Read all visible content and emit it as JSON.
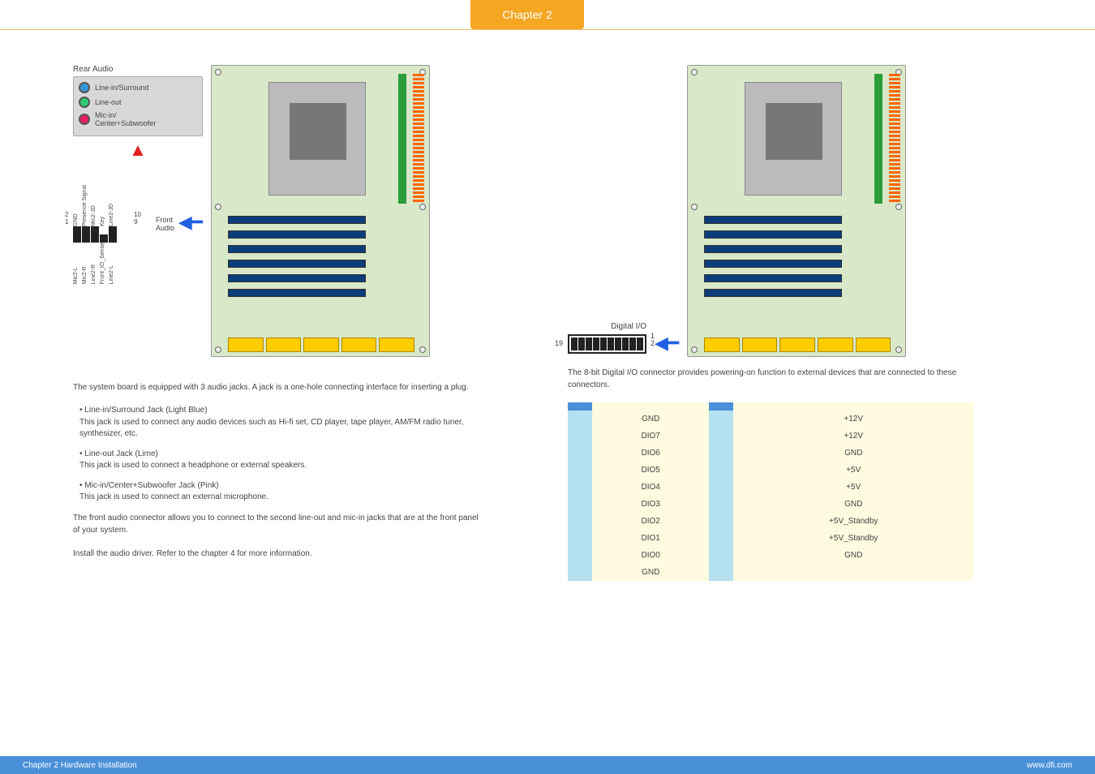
{
  "chapter_tab": "Chapter 2",
  "left": {
    "rear_audio_title": "Rear Audio",
    "jacks": {
      "linein": "Line-in/Surround",
      "lineout": "Line-out",
      "micin": "Mic-in/\nCenter+Subwoofer"
    },
    "front_audio_label": "Front\nAudio",
    "fa_top": [
      "GND",
      "Presence Signal",
      "Mic2-JD",
      "Key",
      "Line2-JD"
    ],
    "fa_bot": [
      "Mic2-L",
      "Mic2-R",
      "Line2-R",
      "Front_IO_Sense",
      "Line2-L"
    ],
    "fa_num": {
      "tl": "2",
      "bl": "1",
      "tr": "10",
      "br": "9"
    },
    "intro": "The system board is equipped with 3 audio jacks. A jack is a one-hole connecting interface for inserting a plug.",
    "bullets": [
      {
        "title": "Line-in/Surround Jack (Light Blue)",
        "body": "This jack is used to connect any audio devices such as Hi-fi set, CD player, tape player, AM/FM radio tuner, synthesizer, etc."
      },
      {
        "title": "Line-out Jack (Lime)",
        "body": "This jack is used to connect a headphone or external speakers."
      },
      {
        "title": "Mic-in/Center+Subwoofer Jack (Pink)",
        "body": "This jack is used to connect an external microphone."
      }
    ],
    "front_audio_desc": "The front audio connector allows you to connect to the second line-out and mic-in jacks that are at the front panel of your system.",
    "driver_note": "Install the audio driver. Refer to the chapter 4 for more information."
  },
  "right": {
    "dio_title": "Digital I/O",
    "dio_num": {
      "left": "19",
      "r1": "1",
      "r2": "2"
    },
    "dio_desc": "The 8-bit Digital I/O connector provides powering-on function to external devices that are connected to these connectors.",
    "table_rows": [
      {
        "a": "GND",
        "b": "+12V"
      },
      {
        "a": "DIO7",
        "b": "+12V"
      },
      {
        "a": "DIO6",
        "b": "GND"
      },
      {
        "a": "DIO5",
        "b": "+5V"
      },
      {
        "a": "DIO4",
        "b": "+5V"
      },
      {
        "a": "DIO3",
        "b": "GND"
      },
      {
        "a": "DIO2",
        "b": "+5V_Standby"
      },
      {
        "a": "DIO1",
        "b": "+5V_Standby"
      },
      {
        "a": "DIO0",
        "b": "GND"
      },
      {
        "a": "GND",
        "b": ""
      }
    ]
  },
  "footer": {
    "left": "Chapter 2 Hardware Installation",
    "right": "www.dfi.com"
  }
}
